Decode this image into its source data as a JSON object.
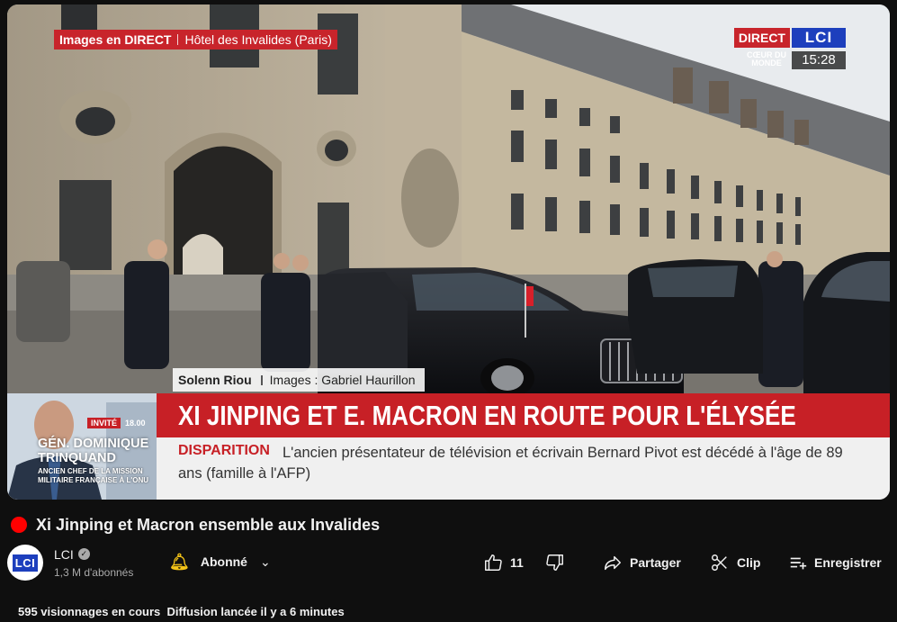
{
  "video": {
    "live_tag_bold": "Images en DIRECT",
    "live_tag_place": "Hôtel des Invalides (Paris)",
    "brand_direct": "DIRECT",
    "brand_lci": "LCI",
    "brand_sub": "CŒUR DU MONDE",
    "clock": "15:28",
    "credit_reporter": "Solenn Riou",
    "credit_images": "Images : Gabriel Haurillon",
    "headline": "XI JINPING ET E. MACRON EN ROUTE POUR L'ÉLYSÉE",
    "ticker_label": "DISPARITION",
    "ticker_text": "L'ancien présentateur de télévision et écrivain Bernard Pivot est décédé à l'âge de 89 ans (famille à l'AFP)",
    "guest_badge": "INVITÉ",
    "guest_time": "18.00",
    "guest_name_line1": "GÉN. DOMINIQUE",
    "guest_name_line2": "TRINQUAND",
    "guest_role": "ANCIEN CHEF DE LA MISSION MILITAIRE FRANÇAISE À L'ONU"
  },
  "info": {
    "title": "Xi Jinping et Macron ensemble aux Invalides",
    "channel_name": "LCI",
    "avatar_text": "LCI",
    "subscribers": "1,3 M d'abonnés",
    "subscribe_label": "Abonné",
    "like_count": "11",
    "share_label": "Partager",
    "clip_label": "Clip",
    "save_label": "Enregistrer",
    "views": "595 visionnages en cours",
    "started": "Diffusion lancée il y a 6 minutes"
  },
  "colors": {
    "lci_blue": "#1d3fbd",
    "news_red": "#c72026",
    "live_red": "#ff0000",
    "bell": "#f5c518"
  },
  "icons": [
    "live-dot",
    "verified-icon",
    "bell-icon",
    "chevron-down-icon",
    "thumb-up-icon",
    "thumb-down-icon",
    "share-icon",
    "scissors-icon",
    "playlist-add-icon"
  ]
}
